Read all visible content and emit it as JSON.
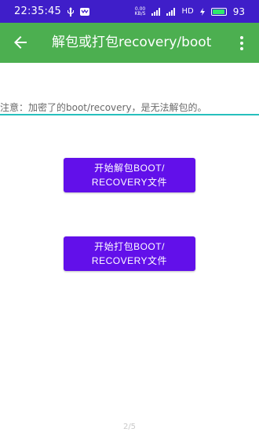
{
  "status_bar": {
    "time": "22:35:45",
    "net_speed_value": "0.00",
    "net_speed_unit": "KB/S",
    "network_label": "HD",
    "battery_level": "93",
    "colors": {
      "background": "#3f1ec9",
      "battery": "#2ee86b"
    },
    "icons": [
      "usb-icon",
      "notification-icon",
      "signal-icon",
      "charging-icon",
      "battery-icon"
    ]
  },
  "toolbar": {
    "title": "解包或打包recovery/boot",
    "color": "#4caf50",
    "icons": [
      "back-arrow-icon",
      "more-vert-icon"
    ]
  },
  "main": {
    "notice": "注意：加密了的boot/recovery，是无法解包的。",
    "unpack_line1": "开始解包BOOT/",
    "unpack_line2": "RECOVERY文件",
    "pack_line1": "开始打包BOOT/",
    "pack_line2": "RECOVERY文件",
    "accent_color": "#6210ea"
  },
  "footer": {
    "page_indicator": "2/5"
  }
}
